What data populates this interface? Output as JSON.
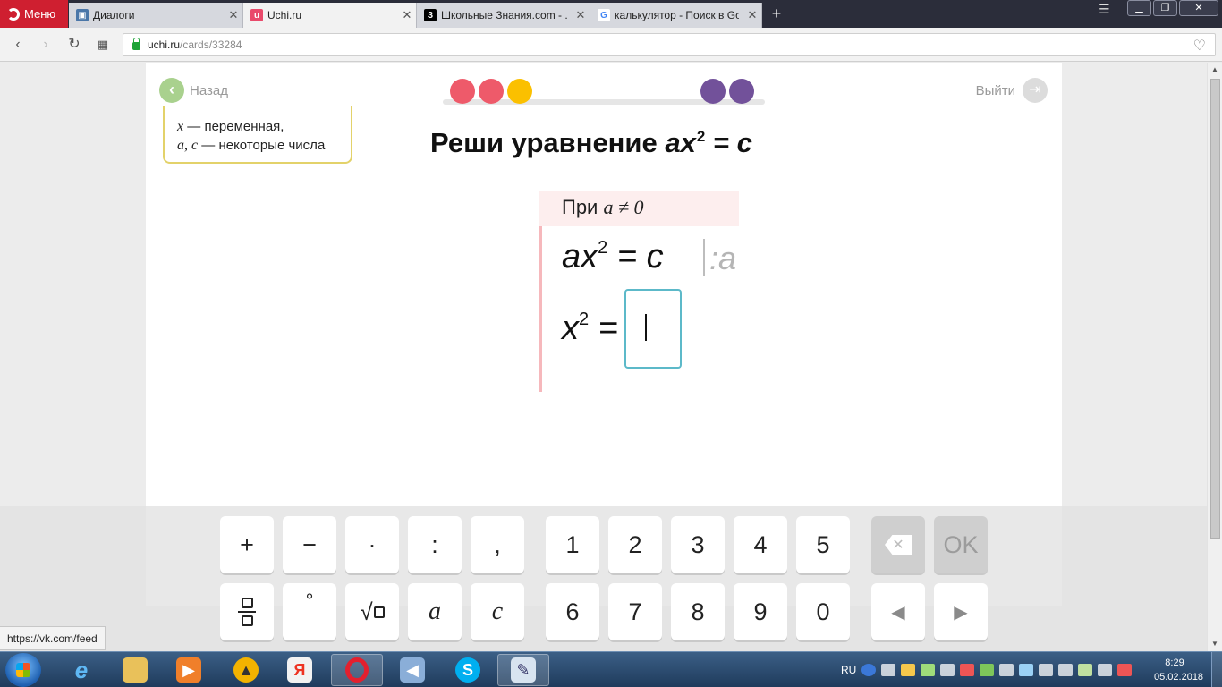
{
  "browser": {
    "menu_label": "Меню",
    "tabs": [
      {
        "title": "Диалоги",
        "favicon": "vk-icon",
        "active": false
      },
      {
        "title": "Uchi.ru",
        "favicon": "uchi-icon",
        "active": true
      },
      {
        "title": "Школьные Знания.com - ...",
        "favicon": "znanija-icon",
        "active": false
      },
      {
        "title": "калькулятор - Поиск в Go",
        "favicon": "google-icon",
        "active": false
      }
    ],
    "url_host": "uchi.ru",
    "url_path": "/cards/33284",
    "status_url": "https://vk.com/feed"
  },
  "page": {
    "back_label": "Назад",
    "exit_label": "Выйти",
    "progress_dots": [
      {
        "color": "#ee5a6a"
      },
      {
        "color": "#ee5a6a"
      },
      {
        "color": "#fbc000"
      },
      {
        "color": "#72519a"
      },
      {
        "color": "#72519a"
      }
    ],
    "hint": {
      "line1_var": "x",
      "line1_text": " — переменная,",
      "line2_var": "a, c",
      "line2_text": " — некоторые числа"
    },
    "title_text": "Реши уравнение ",
    "title_lhs": "ax",
    "title_exp": "2",
    "title_rhs": " = c",
    "condition_prefix": "При ",
    "condition_expr": "a ≠ 0",
    "eq1_lhs": "ax",
    "eq1_exp": "2",
    "eq1_rhs": " = c",
    "eq1_divisor": ":a",
    "eq2_lhs": "x",
    "eq2_exp": "2",
    "eq2_rhs": " ="
  },
  "keyboard": {
    "row1": [
      "+",
      "−",
      "·",
      ":",
      ",",
      "1",
      "2",
      "3",
      "4",
      "5"
    ],
    "row2": [
      "a",
      "c",
      "6",
      "7",
      "8",
      "9",
      "0"
    ],
    "degree": "°",
    "sqrt_symbol": "√",
    "ok_label": "OK",
    "left_arrow": "◀",
    "right_arrow": "▶"
  },
  "taskbar": {
    "lang": "RU",
    "time": "8:29",
    "date": "05.02.2018"
  }
}
